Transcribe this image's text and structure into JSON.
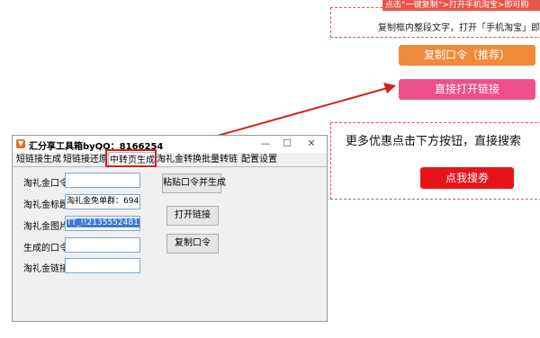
{
  "web": {
    "banner": "点击“一键复制”>打开手机淘宝>即可购",
    "instruction": "复制框内整段文字，打开「手机淘宝」即可领劵",
    "copy_button": "复制口令（推荐）",
    "open_link_button": "直接打开链接",
    "more_text": "更多优惠点击下方按钮，直接搜索",
    "search_button": "点我搜劵",
    "colors": {
      "orange": "#f08a3a",
      "pink": "#f0508a",
      "red": "#e8141c"
    }
  },
  "app": {
    "title": "汇分享工具箱byQQ：8166254",
    "window_controls": {
      "minimize": "—",
      "maximize": "☐",
      "close": "✕"
    },
    "tabs": [
      "短链接生成",
      "短链接还原",
      "中转页生成",
      "淘礼金转换",
      "批量转链",
      "配置设置"
    ],
    "active_tab": "中转页生成",
    "fields": [
      {
        "label": "淘礼金口令",
        "value": ""
      },
      {
        "label": "淘礼金标题",
        "value": "淘礼金免单群：694806"
      },
      {
        "label": "淘礼金图片",
        "value": "TT_!!2135552481.jpg"
      },
      {
        "label": "生成的口令",
        "value": ""
      },
      {
        "label": "淘礼金链接",
        "value": ""
      }
    ],
    "buttons": {
      "paste_generate": "粘贴口令并生成",
      "open_link": "打开链接",
      "copy_code": "复制口令"
    }
  }
}
